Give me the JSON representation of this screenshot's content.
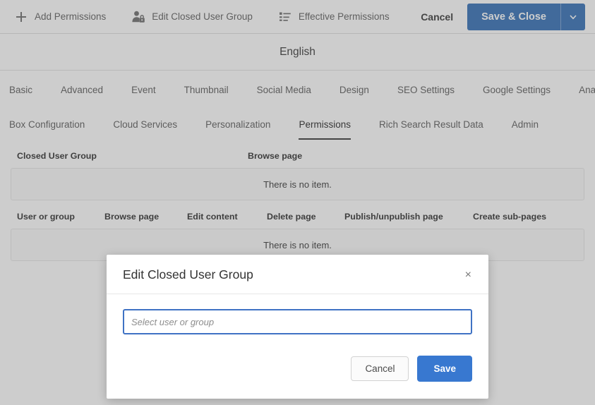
{
  "toolbar": {
    "actions": [
      {
        "label": "Add Permissions",
        "icon": "plus-icon"
      },
      {
        "label": "Edit Closed User Group",
        "icon": "user-lock-icon"
      },
      {
        "label": "Effective Permissions",
        "icon": "list-icon"
      }
    ],
    "cancel_label": "Cancel",
    "save_close_label": "Save & Close",
    "save_close_arrow": "∨",
    "accent_color": "#2f6cb5"
  },
  "language_band": {
    "title": "English"
  },
  "tabs": {
    "row1": [
      {
        "label": "Basic",
        "active": false
      },
      {
        "label": "Advanced",
        "active": false
      },
      {
        "label": "Event",
        "active": false
      },
      {
        "label": "Thumbnail",
        "active": false
      },
      {
        "label": "Social Media",
        "active": false
      },
      {
        "label": "Design",
        "active": false
      },
      {
        "label": "SEO Settings",
        "active": false
      },
      {
        "label": "Google Settings",
        "active": false
      },
      {
        "label": "Analytics",
        "active": false
      }
    ],
    "row2": [
      {
        "label": "Box Configuration",
        "active": false
      },
      {
        "label": "Cloud Services",
        "active": false
      },
      {
        "label": "Personalization",
        "active": false
      },
      {
        "label": "Permissions",
        "active": true
      },
      {
        "label": "Rich Search Result Data",
        "active": false
      },
      {
        "label": "Admin",
        "active": false
      }
    ]
  },
  "cug_table": {
    "headers": [
      "Closed User Group",
      "Browse page"
    ],
    "empty_text": "There is no item."
  },
  "user_table": {
    "headers": [
      "User or group",
      "Browse page",
      "Edit content",
      "Delete page",
      "Publish/unpublish page",
      "Create sub-pages"
    ],
    "empty_text": "There is no item."
  },
  "modal": {
    "title": "Edit Closed User Group",
    "close_icon": "×",
    "input": {
      "value": "",
      "placeholder": "Select user or group"
    },
    "cancel_label": "Cancel",
    "save_label": "Save",
    "save_color": "#3878d0"
  }
}
